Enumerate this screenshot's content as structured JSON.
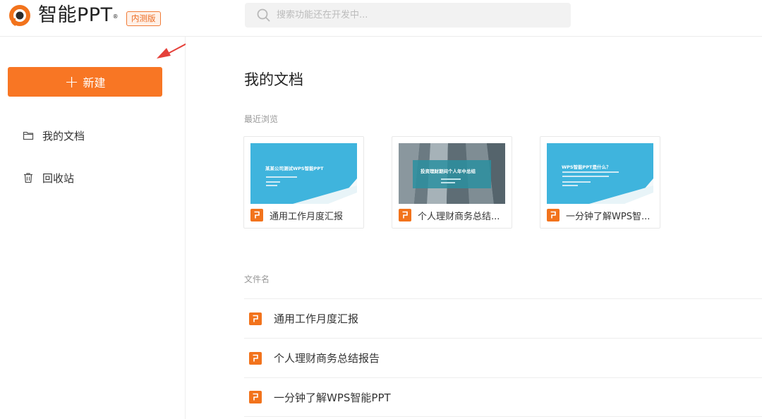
{
  "header": {
    "app_name": "智能PPT",
    "badge": "内测版",
    "search_placeholder": "搜索功能还在开发中..."
  },
  "sidebar": {
    "new_button": "新建",
    "items": [
      {
        "label": "我的文档",
        "icon": "folder-icon"
      },
      {
        "label": "回收站",
        "icon": "trash-icon"
      }
    ]
  },
  "main": {
    "title": "我的文档",
    "recent_label": "最近浏览",
    "recent": [
      {
        "name": "通用工作月度汇报",
        "thumb_headline": "某某公司测试WPS智能PPT"
      },
      {
        "name": "个人理财商务总结...",
        "thumb_headline": "投资理财期间个人年中总结"
      },
      {
        "name": "一分钟了解WPS智...",
        "thumb_headline": "WPS智能PPT是什么？"
      }
    ],
    "file_label": "文件名",
    "files": [
      {
        "name": "通用工作月度汇报"
      },
      {
        "name": "个人理财商务总结报告"
      },
      {
        "name": "一分钟了解WPS智能PPT"
      }
    ]
  },
  "colors": {
    "accent": "#f87624",
    "arrow": "#e5413a",
    "thumb_blue": "#3fb4dd"
  }
}
